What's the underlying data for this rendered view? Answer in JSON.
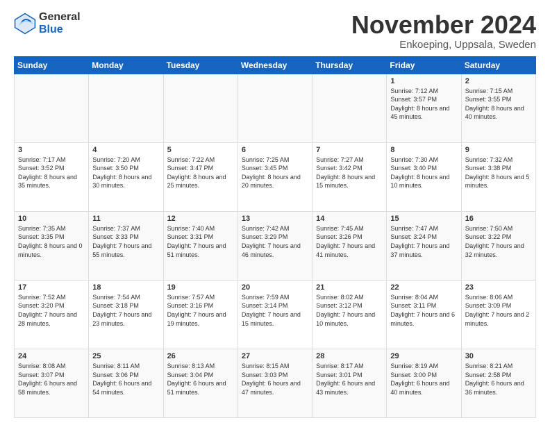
{
  "header": {
    "logo": {
      "general": "General",
      "blue": "Blue"
    },
    "title": "November 2024",
    "subtitle": "Enkoeping, Uppsala, Sweden"
  },
  "weekdays": [
    "Sunday",
    "Monday",
    "Tuesday",
    "Wednesday",
    "Thursday",
    "Friday",
    "Saturday"
  ],
  "weeks": [
    [
      {
        "day": "",
        "info": ""
      },
      {
        "day": "",
        "info": ""
      },
      {
        "day": "",
        "info": ""
      },
      {
        "day": "",
        "info": ""
      },
      {
        "day": "",
        "info": ""
      },
      {
        "day": "1",
        "info": "Sunrise: 7:12 AM\nSunset: 3:57 PM\nDaylight: 8 hours and 45 minutes."
      },
      {
        "day": "2",
        "info": "Sunrise: 7:15 AM\nSunset: 3:55 PM\nDaylight: 8 hours and 40 minutes."
      }
    ],
    [
      {
        "day": "3",
        "info": "Sunrise: 7:17 AM\nSunset: 3:52 PM\nDaylight: 8 hours and 35 minutes."
      },
      {
        "day": "4",
        "info": "Sunrise: 7:20 AM\nSunset: 3:50 PM\nDaylight: 8 hours and 30 minutes."
      },
      {
        "day": "5",
        "info": "Sunrise: 7:22 AM\nSunset: 3:47 PM\nDaylight: 8 hours and 25 minutes."
      },
      {
        "day": "6",
        "info": "Sunrise: 7:25 AM\nSunset: 3:45 PM\nDaylight: 8 hours and 20 minutes."
      },
      {
        "day": "7",
        "info": "Sunrise: 7:27 AM\nSunset: 3:42 PM\nDaylight: 8 hours and 15 minutes."
      },
      {
        "day": "8",
        "info": "Sunrise: 7:30 AM\nSunset: 3:40 PM\nDaylight: 8 hours and 10 minutes."
      },
      {
        "day": "9",
        "info": "Sunrise: 7:32 AM\nSunset: 3:38 PM\nDaylight: 8 hours and 5 minutes."
      }
    ],
    [
      {
        "day": "10",
        "info": "Sunrise: 7:35 AM\nSunset: 3:35 PM\nDaylight: 8 hours and 0 minutes."
      },
      {
        "day": "11",
        "info": "Sunrise: 7:37 AM\nSunset: 3:33 PM\nDaylight: 7 hours and 55 minutes."
      },
      {
        "day": "12",
        "info": "Sunrise: 7:40 AM\nSunset: 3:31 PM\nDaylight: 7 hours and 51 minutes."
      },
      {
        "day": "13",
        "info": "Sunrise: 7:42 AM\nSunset: 3:29 PM\nDaylight: 7 hours and 46 minutes."
      },
      {
        "day": "14",
        "info": "Sunrise: 7:45 AM\nSunset: 3:26 PM\nDaylight: 7 hours and 41 minutes."
      },
      {
        "day": "15",
        "info": "Sunrise: 7:47 AM\nSunset: 3:24 PM\nDaylight: 7 hours and 37 minutes."
      },
      {
        "day": "16",
        "info": "Sunrise: 7:50 AM\nSunset: 3:22 PM\nDaylight: 7 hours and 32 minutes."
      }
    ],
    [
      {
        "day": "17",
        "info": "Sunrise: 7:52 AM\nSunset: 3:20 PM\nDaylight: 7 hours and 28 minutes."
      },
      {
        "day": "18",
        "info": "Sunrise: 7:54 AM\nSunset: 3:18 PM\nDaylight: 7 hours and 23 minutes."
      },
      {
        "day": "19",
        "info": "Sunrise: 7:57 AM\nSunset: 3:16 PM\nDaylight: 7 hours and 19 minutes."
      },
      {
        "day": "20",
        "info": "Sunrise: 7:59 AM\nSunset: 3:14 PM\nDaylight: 7 hours and 15 minutes."
      },
      {
        "day": "21",
        "info": "Sunrise: 8:02 AM\nSunset: 3:12 PM\nDaylight: 7 hours and 10 minutes."
      },
      {
        "day": "22",
        "info": "Sunrise: 8:04 AM\nSunset: 3:11 PM\nDaylight: 7 hours and 6 minutes."
      },
      {
        "day": "23",
        "info": "Sunrise: 8:06 AM\nSunset: 3:09 PM\nDaylight: 7 hours and 2 minutes."
      }
    ],
    [
      {
        "day": "24",
        "info": "Sunrise: 8:08 AM\nSunset: 3:07 PM\nDaylight: 6 hours and 58 minutes."
      },
      {
        "day": "25",
        "info": "Sunrise: 8:11 AM\nSunset: 3:06 PM\nDaylight: 6 hours and 54 minutes."
      },
      {
        "day": "26",
        "info": "Sunrise: 8:13 AM\nSunset: 3:04 PM\nDaylight: 6 hours and 51 minutes."
      },
      {
        "day": "27",
        "info": "Sunrise: 8:15 AM\nSunset: 3:03 PM\nDaylight: 6 hours and 47 minutes."
      },
      {
        "day": "28",
        "info": "Sunrise: 8:17 AM\nSunset: 3:01 PM\nDaylight: 6 hours and 43 minutes."
      },
      {
        "day": "29",
        "info": "Sunrise: 8:19 AM\nSunset: 3:00 PM\nDaylight: 6 hours and 40 minutes."
      },
      {
        "day": "30",
        "info": "Sunrise: 8:21 AM\nSunset: 2:58 PM\nDaylight: 6 hours and 36 minutes."
      }
    ]
  ]
}
